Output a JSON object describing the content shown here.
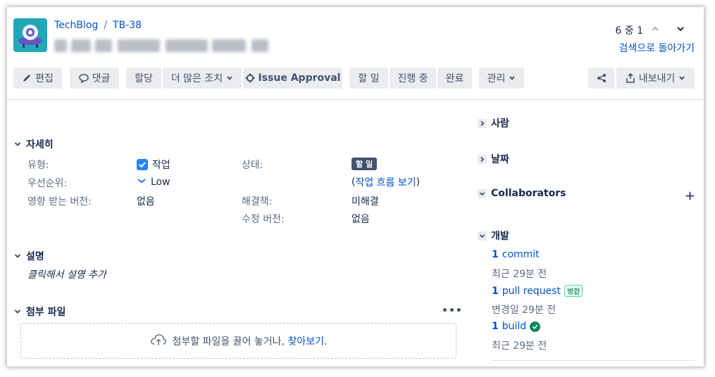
{
  "breadcrumb": {
    "project": "TechBlog",
    "separator": "/",
    "issue_key": "TB-38"
  },
  "pager": {
    "text": "6 중 1",
    "back_label": "검색으로 돌아가기"
  },
  "toolbar": {
    "edit": "편집",
    "comment": "댓글",
    "assign": "할당",
    "more": "더 많은 조치",
    "approval": "Issue Approval",
    "todo": "할 일",
    "in_progress": "진행 중",
    "done": "완료",
    "admin": "관리",
    "export": "내보내기"
  },
  "details": {
    "heading": "자세히",
    "type_label": "유형:",
    "type_value": "작업",
    "priority_label": "우선순위:",
    "priority_value": "Low",
    "affects_label": "영향 받는 버전:",
    "affects_value": "없음",
    "status_label": "상태:",
    "status_value": "할 일",
    "workflow_open": "(",
    "workflow_link": "작업 흐름 보기",
    "workflow_close": ")",
    "resolution_label": "해결책:",
    "resolution_value": "미해결",
    "fix_label": "수정 버전:",
    "fix_value": "없음"
  },
  "description": {
    "heading": "설명",
    "placeholder": "클릭해서 설명 추가"
  },
  "attachments": {
    "heading": "첨부 파일",
    "more": "•••",
    "drop_text": "첨부할 파일을 끌어 놓거나, ",
    "browse": "찾아보기."
  },
  "side": {
    "people": "사람",
    "dates": "날짜",
    "collaborators": "Collaborators",
    "development": "개발",
    "commit_count": "1",
    "commit_label": "commit",
    "commit_time": "최근 29분 전",
    "pr_count": "1",
    "pr_label": "pull request",
    "pr_status": "병합",
    "pr_time": "변경일 29분 전",
    "build_count": "1",
    "build_label": "build",
    "build_time": "최근 29분 전"
  },
  "colors": {
    "link": "#0052cc",
    "brand": "#1fa9b8",
    "checkbox": "#2684ff",
    "success": "#00875a"
  }
}
